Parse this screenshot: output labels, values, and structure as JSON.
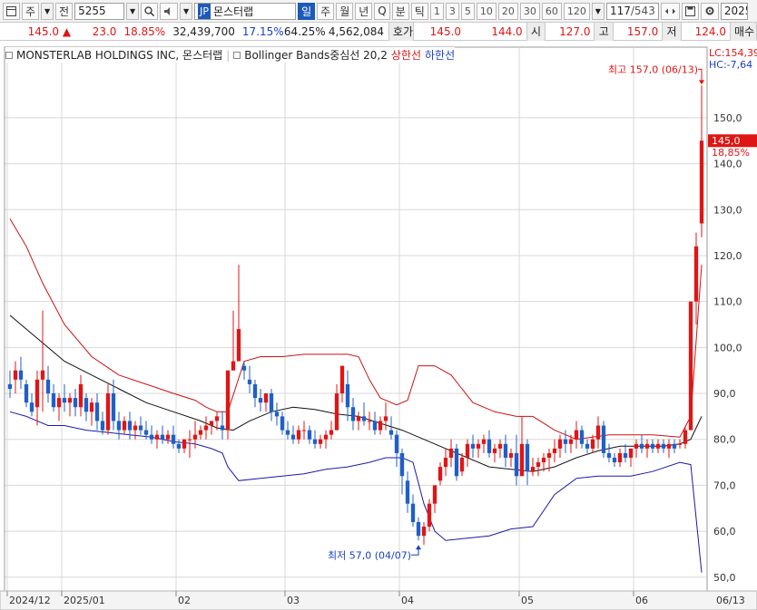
{
  "toolbar": {
    "market_label": "주",
    "period_label": "전",
    "code_value": "5255",
    "country_badge": "JP",
    "stock_name": "몬스터랩",
    "period_buttons": [
      "일",
      "주",
      "월",
      "년",
      "Q",
      "분",
      "틱"
    ],
    "interval_buttons": [
      "1",
      "3",
      "5",
      "10",
      "20",
      "30",
      "60",
      "120"
    ],
    "page_counter": "117",
    "page_total": "/543",
    "date_field": "2025"
  },
  "quote": {
    "price": "145.0",
    "change": "23.0",
    "change_pct": "18.85%",
    "volume": "32,439,700",
    "vol_pct1": "17.15%",
    "vol_pct2": "64.25%",
    "amount": "4,562,084 K",
    "bid_label": "호가",
    "bid_value": "145.0",
    "bid_value2": "144.0",
    "open_label": "시",
    "open_value": "127.0",
    "high_label": "고",
    "high_value": "157.0",
    "low_label": "저",
    "low_value": "124.0",
    "buy_label": "매수"
  },
  "legend": {
    "company": "MONSTERLAB HOLDINGS INC,  몬스터랩",
    "indicator": "Bollinger Bands중심선 20,2",
    "upper": "상한선",
    "lower": "하한선"
  },
  "annotations": {
    "lc": "LC:154,39",
    "hc": "HC:-7,64",
    "price_tag": "145,0",
    "pct_tag": "18,85%",
    "max_label": "최고 157,0 (06/13)",
    "min_label": "최저 57,0 (04/07)"
  },
  "colors": {
    "up": "#e01515",
    "down": "#1f5fc9",
    "middle_band": "#111111",
    "upper_band": "#cc1111",
    "lower_band": "#1a1aa8",
    "grid": "#d8d8d8"
  },
  "chart_data": {
    "type": "candlestick",
    "ylim": [
      47,
      163
    ],
    "y_ticks": [
      50,
      60,
      70,
      80,
      90,
      100,
      110,
      120,
      130,
      140,
      150
    ],
    "y_tick_labels": [
      "50,0",
      "60,0",
      "70,0",
      "80,0",
      "90,0",
      "100,0",
      "110,0",
      "120,0",
      "130,0",
      "140,0",
      "150,0"
    ],
    "x_labels": [
      {
        "label": "2024/12",
        "index": 0
      },
      {
        "label": "2025/01",
        "index": 10
      },
      {
        "label": "02",
        "index": 31
      },
      {
        "label": "03",
        "index": 51
      },
      {
        "label": "04",
        "index": 72
      },
      {
        "label": "05",
        "index": 94
      },
      {
        "label": "06",
        "index": 115
      },
      {
        "label": "06/13",
        "index": 126
      }
    ],
    "ohlc": [
      [
        92,
        95,
        89,
        91
      ],
      [
        93,
        97,
        90,
        95
      ],
      [
        95,
        98,
        91,
        93
      ],
      [
        92,
        93,
        87,
        88
      ],
      [
        88,
        90,
        85,
        86
      ],
      [
        87,
        95,
        83,
        93
      ],
      [
        93,
        108,
        86,
        95
      ],
      [
        93,
        96,
        88,
        90
      ],
      [
        90,
        92,
        86,
        87
      ],
      [
        87,
        90,
        84,
        89
      ],
      [
        89,
        92,
        86,
        88
      ],
      [
        88,
        90,
        85,
        89
      ],
      [
        89,
        91,
        85,
        87
      ],
      [
        87,
        94,
        85,
        92
      ],
      [
        89,
        90,
        84,
        86
      ],
      [
        86,
        89,
        83,
        88
      ],
      [
        88,
        90,
        82,
        84
      ],
      [
        84,
        86,
        81,
        82
      ],
      [
        82,
        92,
        81,
        90
      ],
      [
        90,
        93,
        82,
        84
      ],
      [
        84,
        86,
        80,
        82
      ],
      [
        82,
        85,
        81,
        84
      ],
      [
        84,
        86,
        80,
        82
      ],
      [
        82,
        84,
        80,
        83
      ],
      [
        83,
        85,
        81,
        82
      ],
      [
        82,
        84,
        80,
        81
      ],
      [
        81,
        83,
        79,
        80
      ],
      [
        80,
        82,
        78,
        81
      ],
      [
        81,
        83,
        79,
        80
      ],
      [
        80,
        82,
        79,
        81
      ],
      [
        81,
        83,
        78,
        79
      ],
      [
        79,
        80,
        77,
        78
      ],
      [
        78,
        80,
        77,
        80
      ],
      [
        80,
        82,
        76,
        80
      ],
      [
        80,
        84,
        78,
        81
      ],
      [
        81,
        83,
        80,
        82
      ],
      [
        82,
        85,
        80,
        83
      ],
      [
        83,
        84,
        81,
        84
      ],
      [
        84,
        86,
        82,
        85
      ],
      [
        83,
        86,
        80,
        82
      ],
      [
        82,
        95,
        80,
        95
      ],
      [
        95,
        108,
        95,
        97
      ],
      [
        97,
        118,
        97,
        104
      ],
      [
        96,
        97,
        93,
        95
      ],
      [
        93,
        96,
        90,
        92
      ],
      [
        92,
        93,
        87,
        89
      ],
      [
        89,
        91,
        86,
        88
      ],
      [
        88,
        90,
        86,
        90
      ],
      [
        90,
        91,
        84,
        86
      ],
      [
        86,
        88,
        83,
        85
      ],
      [
        85,
        86,
        81,
        82
      ],
      [
        82,
        84,
        80,
        81
      ],
      [
        81,
        83,
        79,
        80
      ],
      [
        80,
        83,
        79,
        82
      ],
      [
        82,
        84,
        80,
        82
      ],
      [
        82,
        83,
        79,
        80
      ],
      [
        80,
        82,
        78,
        79
      ],
      [
        79,
        81,
        78,
        80
      ],
      [
        80,
        82,
        78,
        81
      ],
      [
        81,
        84,
        80,
        82
      ],
      [
        82,
        92,
        82,
        90
      ],
      [
        90,
        96,
        88,
        96
      ],
      [
        92,
        95,
        84,
        87
      ],
      [
        87,
        89,
        82,
        84
      ],
      [
        84,
        86,
        82,
        85
      ],
      [
        85,
        88,
        83,
        84
      ],
      [
        84,
        86,
        82,
        84
      ],
      [
        84,
        86,
        81,
        82
      ],
      [
        82,
        85,
        81,
        84
      ],
      [
        84,
        88,
        82,
        85
      ],
      [
        82,
        85,
        80,
        81
      ],
      [
        81,
        82,
        74,
        77
      ],
      [
        77,
        78,
        68,
        72
      ],
      [
        71,
        73,
        64,
        66
      ],
      [
        66,
        68,
        61,
        62
      ],
      [
        62,
        63,
        58,
        59
      ],
      [
        59,
        62,
        57,
        61
      ],
      [
        61,
        67,
        60,
        66
      ],
      [
        66,
        70,
        64,
        70
      ],
      [
        71,
        75,
        70,
        74
      ],
      [
        74,
        78,
        72,
        76
      ],
      [
        76,
        80,
        74,
        78
      ],
      [
        78,
        79,
        71,
        72
      ],
      [
        73,
        77,
        72,
        76
      ],
      [
        76,
        80,
        74,
        79
      ],
      [
        79,
        81,
        76,
        78
      ],
      [
        78,
        80,
        76,
        79
      ],
      [
        79,
        81,
        77,
        80
      ],
      [
        80,
        82,
        76,
        77
      ],
      [
        77,
        79,
        75,
        78
      ],
      [
        78,
        80,
        76,
        79
      ],
      [
        79,
        81,
        74,
        76
      ],
      [
        76,
        78,
        74,
        77
      ],
      [
        77,
        81,
        70,
        72
      ],
      [
        72,
        85,
        72,
        79
      ],
      [
        79,
        80,
        70,
        73
      ],
      [
        73,
        76,
        72,
        74
      ],
      [
        74,
        76,
        72,
        75
      ],
      [
        75,
        77,
        73,
        76
      ],
      [
        76,
        78,
        73,
        77
      ],
      [
        77,
        80,
        75,
        78
      ],
      [
        78,
        81,
        76,
        80
      ],
      [
        80,
        82,
        77,
        79
      ],
      [
        79,
        81,
        77,
        80
      ],
      [
        80,
        84,
        78,
        82
      ],
      [
        82,
        83,
        78,
        79
      ],
      [
        79,
        80,
        77,
        78
      ],
      [
        78,
        81,
        77,
        80
      ],
      [
        80,
        85,
        78,
        83
      ],
      [
        83,
        84,
        76,
        77
      ],
      [
        77,
        79,
        75,
        76
      ],
      [
        76,
        77,
        74,
        75
      ],
      [
        75,
        78,
        74,
        77
      ],
      [
        77,
        79,
        75,
        76
      ],
      [
        76,
        78,
        74,
        78
      ],
      [
        78,
        80,
        76,
        79
      ],
      [
        79,
        81,
        77,
        78
      ],
      [
        78,
        80,
        76,
        79
      ],
      [
        79,
        80,
        77,
        78
      ],
      [
        78,
        80,
        77,
        79
      ],
      [
        79,
        80,
        77,
        78
      ],
      [
        78,
        80,
        76,
        79
      ],
      [
        79,
        80,
        77,
        78
      ],
      [
        79,
        80,
        78,
        79
      ],
      [
        79,
        83,
        78,
        82
      ],
      [
        82,
        110,
        82,
        110
      ],
      [
        110,
        125,
        105,
        122
      ],
      [
        127,
        157,
        124,
        145
      ]
    ],
    "middle_band": [
      [
        0,
        107
      ],
      [
        5,
        102
      ],
      [
        10,
        97
      ],
      [
        15,
        94
      ],
      [
        20,
        91
      ],
      [
        25,
        88
      ],
      [
        30,
        86
      ],
      [
        35,
        84
      ],
      [
        38,
        82.5
      ],
      [
        41,
        82
      ],
      [
        44,
        84
      ],
      [
        48,
        86
      ],
      [
        52,
        87
      ],
      [
        56,
        86.5
      ],
      [
        60,
        85.5
      ],
      [
        64,
        85
      ],
      [
        68,
        83.5
      ],
      [
        72,
        82
      ],
      [
        76,
        80
      ],
      [
        80,
        78
      ],
      [
        84,
        76
      ],
      [
        88,
        74
      ],
      [
        92,
        73.5
      ],
      [
        96,
        73
      ],
      [
        100,
        74
      ],
      [
        104,
        76
      ],
      [
        108,
        77.5
      ],
      [
        112,
        78.5
      ],
      [
        116,
        78.5
      ],
      [
        120,
        78.5
      ],
      [
        123,
        79
      ],
      [
        125,
        80
      ],
      [
        127,
        85
      ]
    ],
    "upper_band": [
      [
        0,
        128
      ],
      [
        3,
        122
      ],
      [
        6,
        114
      ],
      [
        10,
        105
      ],
      [
        15,
        98
      ],
      [
        20,
        94
      ],
      [
        25,
        92
      ],
      [
        30,
        90
      ],
      [
        34,
        88.5
      ],
      [
        36,
        87
      ],
      [
        38,
        86
      ],
      [
        40,
        86
      ],
      [
        43,
        97
      ],
      [
        46,
        98
      ],
      [
        50,
        98
      ],
      [
        54,
        98.5
      ],
      [
        58,
        98.5
      ],
      [
        62,
        98.5
      ],
      [
        64,
        98
      ],
      [
        66,
        93
      ],
      [
        68,
        89
      ],
      [
        71,
        87.5
      ],
      [
        73,
        88.5
      ],
      [
        75,
        96
      ],
      [
        78,
        96
      ],
      [
        81,
        94
      ],
      [
        85,
        88
      ],
      [
        89,
        86
      ],
      [
        93,
        85
      ],
      [
        96,
        85
      ],
      [
        100,
        82
      ],
      [
        104,
        80
      ],
      [
        110,
        81
      ],
      [
        118,
        81
      ],
      [
        123,
        80.5
      ],
      [
        125,
        85
      ],
      [
        127,
        118
      ]
    ],
    "lower_band": [
      [
        0,
        86
      ],
      [
        3,
        85
      ],
      [
        5,
        84
      ],
      [
        7,
        83
      ],
      [
        10,
        83
      ],
      [
        14,
        82
      ],
      [
        18,
        81.5
      ],
      [
        22,
        81
      ],
      [
        26,
        80.5
      ],
      [
        30,
        79.5
      ],
      [
        34,
        79
      ],
      [
        37,
        78
      ],
      [
        39,
        77
      ],
      [
        40,
        74
      ],
      [
        42,
        71
      ],
      [
        46,
        71.5
      ],
      [
        50,
        72
      ],
      [
        54,
        72.5
      ],
      [
        58,
        73.5
      ],
      [
        62,
        74
      ],
      [
        66,
        75
      ],
      [
        69,
        76
      ],
      [
        72,
        76
      ],
      [
        74,
        75
      ],
      [
        76,
        66
      ],
      [
        78,
        60
      ],
      [
        80,
        58
      ],
      [
        84,
        58.5
      ],
      [
        88,
        59
      ],
      [
        92,
        60.5
      ],
      [
        96,
        61
      ],
      [
        100,
        68
      ],
      [
        104,
        71.5
      ],
      [
        108,
        72
      ],
      [
        114,
        72
      ],
      [
        118,
        73
      ],
      [
        123,
        75
      ],
      [
        125,
        74.5
      ],
      [
        127,
        51
      ]
    ]
  }
}
